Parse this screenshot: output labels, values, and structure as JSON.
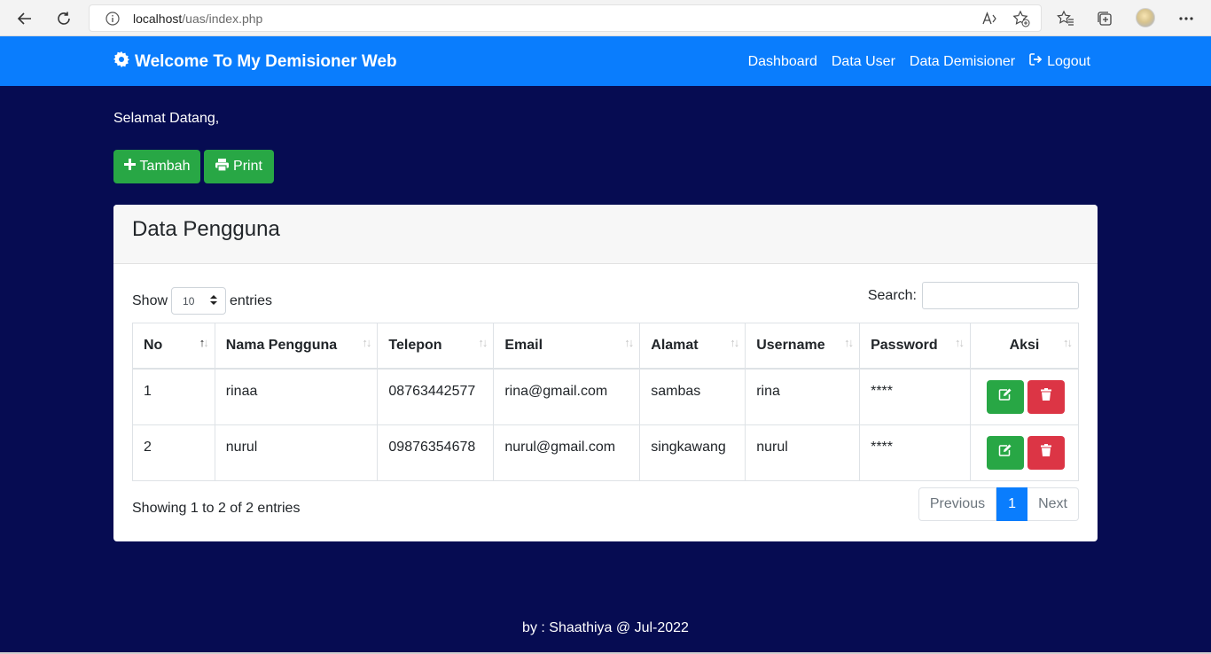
{
  "browser": {
    "url_host": "localhost",
    "url_path": "/uas/index.php"
  },
  "navbar": {
    "brand": "Welcome To My Demisioner Web",
    "links": [
      "Dashboard",
      "Data User",
      "Data Demisioner"
    ],
    "logout": "Logout",
    "color": "#0a7dfd"
  },
  "page": {
    "greeting": "Selamat Datang,",
    "buttons": {
      "add": "Tambah",
      "print": "Print"
    },
    "background": "#060c52"
  },
  "card": {
    "title": "Data Pengguna",
    "show_label": "Show",
    "entries_label": "entries",
    "page_length": "10",
    "search_label": "Search:",
    "columns": [
      "No",
      "Nama Pengguna",
      "Telepon",
      "Email",
      "Alamat",
      "Username",
      "Password",
      "Aksi"
    ],
    "rows": [
      {
        "no": "1",
        "nama": "rinaa",
        "telepon": "08763442577",
        "email": "rina@gmail.com",
        "alamat": "sambas",
        "username": "rina",
        "password": "****"
      },
      {
        "no": "2",
        "nama": "nurul",
        "telepon": "09876354678",
        "email": "nurul@gmail.com",
        "alamat": "singkawang",
        "username": "nurul",
        "password": "****"
      }
    ],
    "info": "Showing 1 to 2 of 2 entries",
    "pagination": {
      "previous": "Previous",
      "current": "1",
      "next": "Next"
    }
  },
  "footer": {
    "text": "by : Shaathiya @ Jul-2022"
  }
}
